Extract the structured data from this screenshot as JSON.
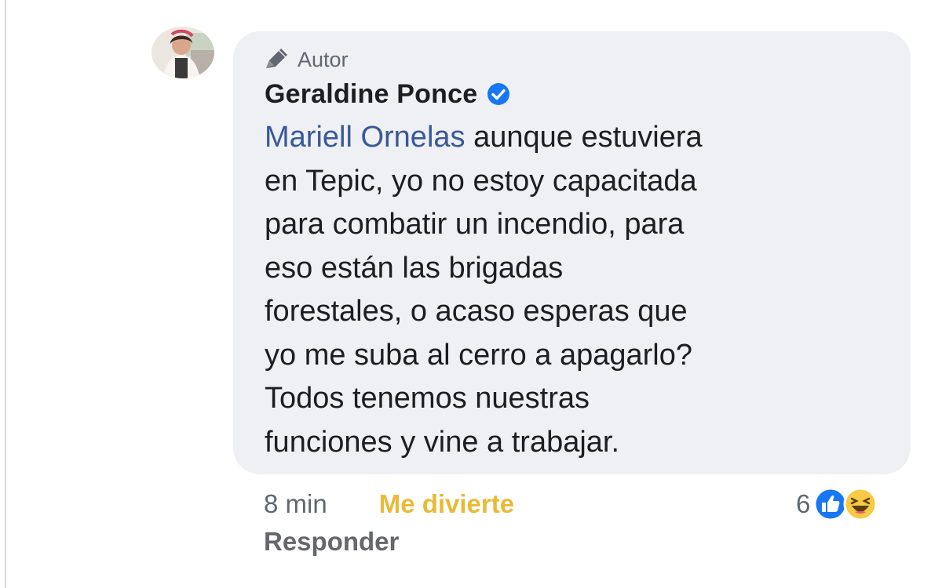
{
  "comment": {
    "badge_label": "Autor",
    "author_name": "Geraldine Ponce",
    "mention": "Mariell Ornelas",
    "text_lines": [
      " aunque estuviera",
      "en Tepic, yo no estoy capacitada",
      "para combatir un incendio, para",
      "eso están las brigadas",
      "forestales, o acaso esperas que",
      "yo me suba al cerro a apagarlo?",
      "Todos tenemos nuestras",
      "funciones y vine a trabajar."
    ]
  },
  "actions": {
    "time": "8 min",
    "reaction_label": "Me divierte",
    "reply_label": "Responder"
  },
  "reactions": {
    "count": "6",
    "icons": [
      "like-icon",
      "haha-icon"
    ]
  },
  "colors": {
    "bubble": "#eef0f3",
    "mention": "#385898",
    "reaction_haha": "#e8ba36",
    "verified": "#1877f2"
  }
}
